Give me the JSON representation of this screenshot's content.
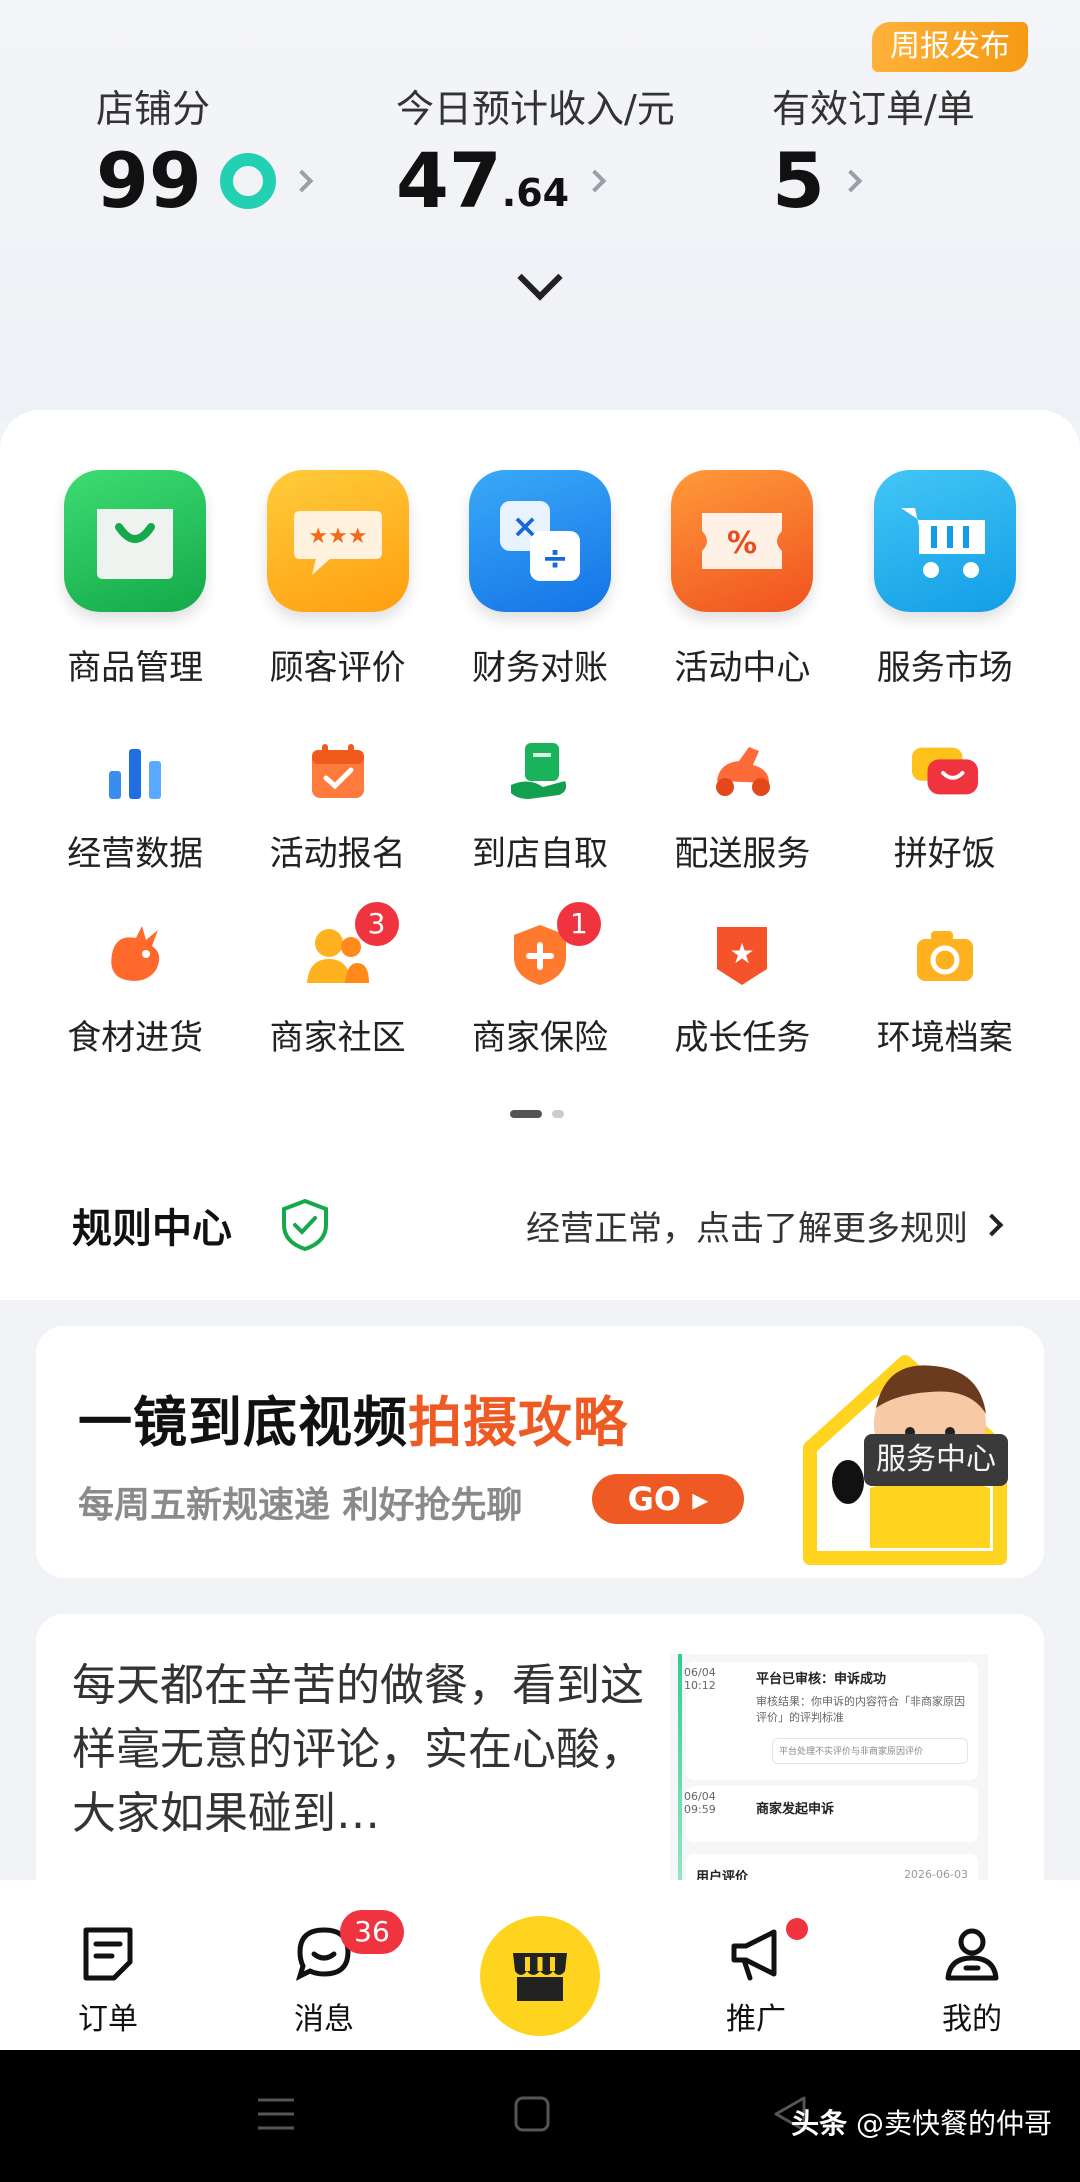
{
  "header": {
    "weekly_badge": "周报发布",
    "stats": [
      {
        "label": "店铺分",
        "value": "99",
        "decimal": ""
      },
      {
        "label": "今日预计收入/元",
        "value": "47",
        "decimal": ".64"
      },
      {
        "label": "有效订单/单",
        "value": "5",
        "decimal": ""
      }
    ]
  },
  "main_apps": [
    {
      "label": "商品管理",
      "icon": "shopping-bag-icon",
      "color": "#23c45e"
    },
    {
      "label": "顾客评价",
      "icon": "rating-bubble-icon",
      "color": "#ffb51f"
    },
    {
      "label": "财务对账",
      "icon": "calculator-icon",
      "color": "#1f8ff0"
    },
    {
      "label": "活动中心",
      "icon": "discount-ticket-icon",
      "color": "#f5742a"
    },
    {
      "label": "服务市场",
      "icon": "cart-icon",
      "color": "#25b4ef"
    }
  ],
  "tools_row1": [
    {
      "label": "经营数据",
      "icon": "bar-chart-icon"
    },
    {
      "label": "活动报名",
      "icon": "calendar-check-icon"
    },
    {
      "label": "到店自取",
      "icon": "pickup-icon"
    },
    {
      "label": "配送服务",
      "icon": "scooter-icon"
    },
    {
      "label": "拼好饭",
      "icon": "bowl-icon"
    }
  ],
  "tools_row2": [
    {
      "label": "食材进货",
      "icon": "kangaroo-icon",
      "badge": ""
    },
    {
      "label": "商家社区",
      "icon": "community-icon",
      "badge": "3"
    },
    {
      "label": "商家保险",
      "icon": "insurance-shield-icon",
      "badge": "1"
    },
    {
      "label": "成长任务",
      "icon": "star-badge-icon",
      "badge": ""
    },
    {
      "label": "环境档案",
      "icon": "camera-icon",
      "badge": ""
    }
  ],
  "rules": {
    "title": "规则中心",
    "status": "经营正常，点击了解更多规则"
  },
  "banner": {
    "title_main": "一镜到底视频",
    "title_highlight": "拍摄攻略",
    "subtitle": "每周五新规速递 利好抢先聊",
    "go_label": "GO",
    "service_tag": "服务中心"
  },
  "article": {
    "text": "每天都在辛苦的做餐，看到这样毫无意的评论，实在心酸，大家如果碰到…",
    "thumb": {
      "date1": "06/04",
      "time1": "10:12",
      "title1": "平台已审核：申诉成功",
      "body1": "审核结果：你申诉的内容符合「非商家原因评价」的评判标准",
      "note1": "平台处理不实评价与非商家原因评价",
      "date2": "06/04",
      "time2": "09:59",
      "title2": "商家发起申诉",
      "review_label": "用户评价",
      "review_date": "2026-06-03"
    }
  },
  "tabbar": {
    "tabs": [
      {
        "label": "订单",
        "icon": "order-icon"
      },
      {
        "label": "消息",
        "icon": "message-icon",
        "badge": "36"
      },
      {
        "label": "",
        "icon": "store-icon"
      },
      {
        "label": "推广",
        "icon": "megaphone-icon"
      },
      {
        "label": "我的",
        "icon": "profile-icon"
      }
    ]
  },
  "watermark": {
    "brand": "头条",
    "author": "@卖快餐的仲哥"
  },
  "colors": {
    "accent_orange": "#ef5a24",
    "badge_red": "#f0343f",
    "center_yellow": "#ffd41f",
    "ring_teal": "#23d0b1"
  }
}
